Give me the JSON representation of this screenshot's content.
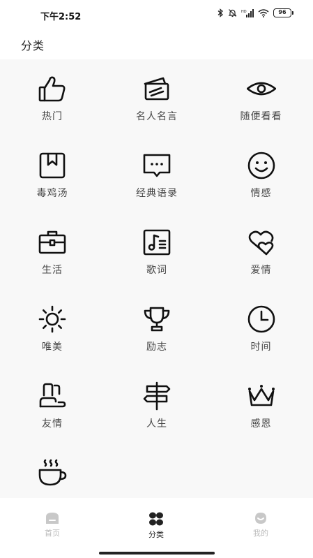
{
  "status": {
    "time": "下午2:52",
    "battery": "96"
  },
  "header": {
    "title": "分类"
  },
  "categories": [
    {
      "label": "热门",
      "icon": "thumbs-up-icon"
    },
    {
      "label": "名人名言",
      "icon": "cards-icon"
    },
    {
      "label": "随便看看",
      "icon": "eye-icon"
    },
    {
      "label": "毒鸡汤",
      "icon": "bookmark-box-icon"
    },
    {
      "label": "经典语录",
      "icon": "message-dots-icon"
    },
    {
      "label": "情感",
      "icon": "smiley-icon"
    },
    {
      "label": "生活",
      "icon": "briefcase-icon"
    },
    {
      "label": "歌词",
      "icon": "music-note-icon"
    },
    {
      "label": "爱情",
      "icon": "hearts-icon"
    },
    {
      "label": "唯美",
      "icon": "sun-icon"
    },
    {
      "label": "励志",
      "icon": "trophy-icon"
    },
    {
      "label": "时间",
      "icon": "clock-icon"
    },
    {
      "label": "友情",
      "icon": "friends-icon"
    },
    {
      "label": "人生",
      "icon": "signpost-icon"
    },
    {
      "label": "感恩",
      "icon": "crown-icon"
    },
    {
      "label": "",
      "icon": "coffee-cup-icon"
    }
  ],
  "tabs": [
    {
      "label": "首页",
      "icon": "home-icon",
      "active": false
    },
    {
      "label": "分类",
      "icon": "four-leaf-icon",
      "active": true
    },
    {
      "label": "我的",
      "icon": "profile-icon",
      "active": false
    }
  ],
  "colors": {
    "active": "#222222",
    "inactive": "#bbbbbb",
    "background": "#f8f8f8"
  }
}
